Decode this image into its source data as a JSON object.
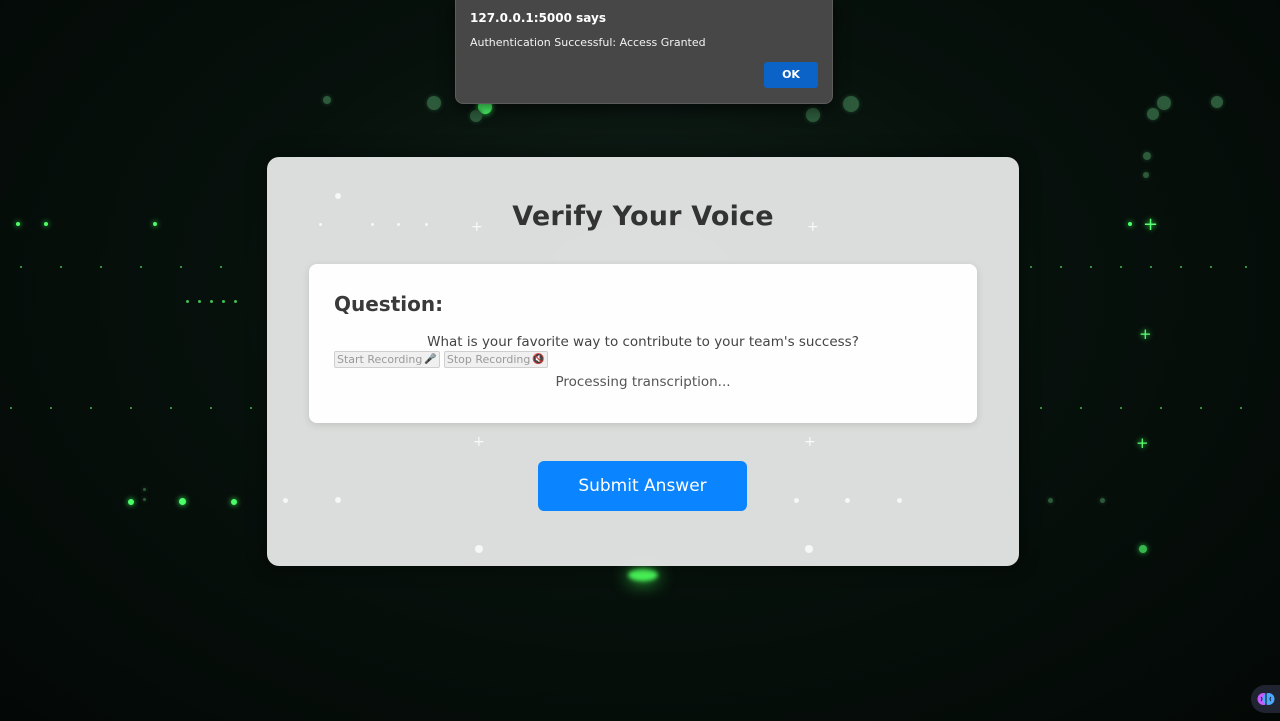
{
  "alert": {
    "title": "127.0.0.1:5000 says",
    "message": "Authentication Successful: Access Granted",
    "ok_label": "OK"
  },
  "card": {
    "title": "Verify Your Voice",
    "question_heading": "Question:",
    "question_text": "What is your favorite way to contribute to your team's success?",
    "start_recording_label": "Start Recording",
    "stop_recording_label": "Stop Recording",
    "status_text": "Processing transcription...",
    "submit_label": "Submit Answer"
  },
  "icons": {
    "start_recording": "microphone-icon",
    "stop_recording": "muted-microphone-icon",
    "corner_badge": "brain-icon"
  },
  "colors": {
    "submit_button": "#0a84ff",
    "alert_ok": "#0b63c7",
    "alert_background": "#474747",
    "particle_green": "#4cff6a"
  }
}
